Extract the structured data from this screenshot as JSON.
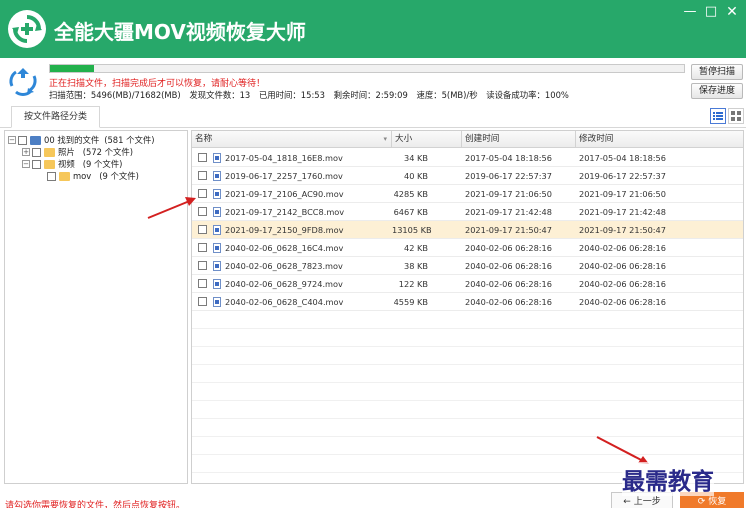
{
  "app": {
    "title": "全能大疆MOV视频恢复大师",
    "window_controls": [
      "minimize",
      "maximize",
      "close"
    ]
  },
  "scan": {
    "progress": 0.07,
    "message": "正在扫描文件，扫描完成后才可以恢复，请耐心等待！",
    "range": "扫描范围：5496(MB)/71682(MB)",
    "found": "发现文件数：13",
    "elapsed": "已用时间：15:53",
    "remaining": "剩余时间：2:59:09",
    "speed": "速度：5(MB)/秒",
    "read_success": "读设备成功率：100%",
    "pause_label": "暂停扫描",
    "save_label": "保存进度"
  },
  "tabs": [
    {
      "label": "按文件路径分类"
    }
  ],
  "tree": {
    "root": {
      "label": "00 找到的文件",
      "count": "(581 个文件)"
    },
    "items": [
      {
        "label": "照片",
        "count": "(572 个文件)"
      },
      {
        "label": "视频",
        "count": "(9 个文件)"
      },
      {
        "label": "mov",
        "count": "(9 个文件)"
      }
    ]
  },
  "table": {
    "columns": [
      "名称",
      "大小",
      "创建时间",
      "修改时间"
    ],
    "rows": [
      {
        "name": "2017-05-04_1818_16E8.mov",
        "size": "34 KB",
        "created": "2017-05-04  18:18:56",
        "modified": "2017-05-04  18:18:56"
      },
      {
        "name": "2019-06-17_2257_1760.mov",
        "size": "40 KB",
        "created": "2019-06-17  22:57:37",
        "modified": "2019-06-17  22:57:37"
      },
      {
        "name": "2021-09-17_2106_AC90.mov",
        "size": "4285 KB",
        "created": "2021-09-17  21:06:50",
        "modified": "2021-09-17  21:06:50"
      },
      {
        "name": "2021-09-17_2142_BCC8.mov",
        "size": "6467 KB",
        "created": "2021-09-17  21:42:48",
        "modified": "2021-09-17  21:42:48"
      },
      {
        "name": "2021-09-17_2150_9FD8.mov",
        "size": "13105 KB",
        "created": "2021-09-17  21:50:47",
        "modified": "2021-09-17  21:50:47",
        "selected": true
      },
      {
        "name": "2040-02-06_0628_16C4.mov",
        "size": "42 KB",
        "created": "2040-02-06  06:28:16",
        "modified": "2040-02-06  06:28:16"
      },
      {
        "name": "2040-02-06_0628_7823.mov",
        "size": "38 KB",
        "created": "2040-02-06  06:28:16",
        "modified": "2040-02-06  06:28:16"
      },
      {
        "name": "2040-02-06_0628_9724.mov",
        "size": "122 KB",
        "created": "2040-02-06  06:28:16",
        "modified": "2040-02-06  06:28:16"
      },
      {
        "name": "2040-02-06_0628_C404.mov",
        "size": "4559 KB",
        "created": "2040-02-06  06:28:16",
        "modified": "2040-02-06  06:28:16"
      }
    ]
  },
  "footer": {
    "tip": "请勾选你需要恢复的文件，然后点恢复按钮。",
    "prev_label": "上一步",
    "recover_label": "恢复"
  },
  "watermark": "最需教育",
  "colors": {
    "header": "#27a86a",
    "progress": "#22b14c",
    "warning_text": "#e02020",
    "selected_row": "#fdf0d5",
    "recover_button": "#f07a2a",
    "annotation_arrow": "#d32020"
  }
}
